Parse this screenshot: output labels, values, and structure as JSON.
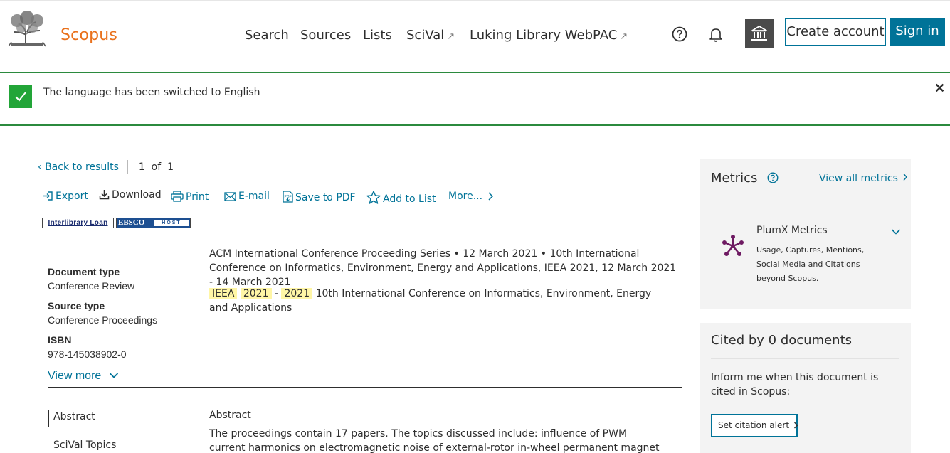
{
  "header": {
    "logo_text": "Scopus",
    "nav": [
      {
        "label": "Search",
        "external": false
      },
      {
        "label": "Sources",
        "external": false
      },
      {
        "label": "Lists",
        "external": false
      },
      {
        "label": "SciVal",
        "external": true
      },
      {
        "label": "Luking Library WebPAC",
        "external": true
      }
    ],
    "external_glyph": "↗",
    "create_account": "Create account",
    "sign_in": "Sign in",
    "icons": [
      "help-icon",
      "bell-icon",
      "institution-icon"
    ]
  },
  "notice": {
    "text": "The language has been switched to English",
    "close": "✕"
  },
  "navigation": {
    "back": "Back to results",
    "pager_current": "1",
    "pager_of": "of",
    "pager_total": "1"
  },
  "toolbar": {
    "export": "Export",
    "download": "Download",
    "print": "Print",
    "email": "E-mail",
    "save_pdf": "Save to PDF",
    "add_list": "Add to List",
    "more": "More..."
  },
  "badges": {
    "ill": "Interlibrary Loan",
    "ebsco_1": "EBSCO",
    "ebsco_2": "HOST"
  },
  "document": {
    "source_series": "ACM International Conference Proceeding Series",
    "source_date": "12 March 2021",
    "source_conf": "10th International Conference on Informatics, Environment, Energy and Applications, IEEA 2021, 12 March 2021 - 14 March 2021",
    "title_hl_1": "IEEA",
    "title_hl_2": "2021",
    "title_dash": "-",
    "title_hl_3": "2021",
    "title_rest": "10th International Conference on Informatics, Environment, Energy and Applications",
    "doc_type_label": "Document type",
    "doc_type_value": "Conference Review",
    "source_type_label": "Source type",
    "source_type_value": "Conference Proceedings",
    "isbn_label": "ISBN",
    "isbn_value": "978-145038902-0",
    "view_more": "View more"
  },
  "sections": {
    "nav_abstract": "Abstract",
    "nav_scival": "SciVal Topics",
    "abstract_heading": "Abstract",
    "abstract_text": "The proceedings contain 17 papers. The topics discussed include: influence of PWM current harmonics on electromagnetic noise of external-rotor in-wheel permanent magnet synchronous"
  },
  "metrics": {
    "title": "Metrics",
    "view_all": "View all metrics",
    "plumx_title": "PlumX Metrics",
    "plumx_desc_1": "Usage, Captures, Mentions,",
    "plumx_desc_2": "Social Media and Citations",
    "plumx_desc_3": "beyond Scopus."
  },
  "cited": {
    "title": "Cited by 0 documents",
    "desc": "Inform me when this document is cited in Scopus:",
    "alert_button": "Set citation alert"
  },
  "colors": {
    "brand_orange": "#e9711c",
    "link_blue": "#007398",
    "success_green": "#22a538",
    "highlight_yellow": "#fff6a6",
    "plumx_purple": "#6e1a62"
  }
}
